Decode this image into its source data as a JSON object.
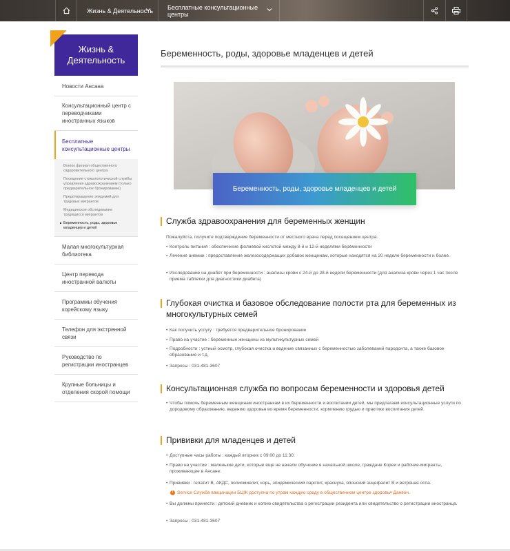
{
  "topbar": {
    "crumb1": "Жизнь & Деятельность",
    "crumb2": "Бесплатные консультационные центры"
  },
  "sidebar": {
    "title": "Жизнь & Деятельность",
    "items": [
      {
        "label": "Новости Ансана"
      },
      {
        "label": "Консультационный центр с переводчиками иностранных языков"
      },
      {
        "label": "Бесплатные консультационные центры"
      },
      {
        "label": "Малая многокультурная библиотека"
      },
      {
        "label": "Центр перевода иностранной валюты"
      },
      {
        "label": "Программы обучения корейскому языку"
      },
      {
        "label": "Телефон для экстренной связи"
      },
      {
        "label": "Руководство по регистрации иностранцев"
      },
      {
        "label": "Крупные больницы и отделения скорой помощи"
      }
    ],
    "subitems": [
      {
        "label": "Вонгок филиал общественного оздоровительного центра"
      },
      {
        "label": "Посещение стоматологической службы управления здравоохранением (только предварительное бронирование)"
      },
      {
        "label": "Предотвращение эпидемий для трудовых мигрантов"
      },
      {
        "label": "Медицинское обследование трудящихся мигрантов"
      },
      {
        "label": "Беременность, роды, здоровье младенцев и детей"
      }
    ]
  },
  "main": {
    "title": "Беременность, роды, здоровье младенцев и детей",
    "hero_caption": "Беременность, роды, здоровье младенцев и детей",
    "s1": {
      "title": "Служба здравоохранения для беременных женщин",
      "intro": "Пожалуйста, получите подтверждение беременности от местного врача перед посещением центра.",
      "b1": "Контроль питания : обеспечение фолиевой кислотой между 8-й и 12-й неделями беременности",
      "b2": "Лечение анемии : предоставление железосодержащих добавок женщинам, которые находятся на 20 неделе беременности и более.",
      "b3": "Исследование на диабет при беременности : анализы крови с 24-й до 28-й недели беременности (для анализа крови через 1 час после приема таблетки для диагностики диабета)"
    },
    "s2": {
      "title": "Глубокая очистка и базовое обследование полости рта для беременных из многокультурных семей",
      "b1": "Как получить услугу : требуется предварительное бронирование",
      "b2": "Право на участие : беременные женщины из мультикультурных семей",
      "b3": "Подробности : устный осмотр, глубокая очистка и ведение связанных с беременностью заболеваний пародонта, а также базовое образование и т.д.",
      "b4": "Запросы : 031-481-3607"
    },
    "s3": {
      "title": "Консультационная служба по вопросам беременности и здоровья детей",
      "b1": "Чтобы помочь беременным женщинам иностранкам в их беременности и воспитании детей, мы предлагаем консультационные услуги по дородовому образованию, ведению здоровья во время беременности, кормлению грудью и практике воспитания детей."
    },
    "s4": {
      "title": "Прививки для младенцев и детей",
      "b1": "Доступные часы работы : каждый вторник с 09:00 до 11:30.",
      "b2": "Право на участие : маленькие дети, которые еще не начали обучение в начальной школе, граждане Кореи и рабочие-мигранты, проживающие в Ансане.",
      "b3": "Прививки : гепатит B, АКДС, полиомиелит, корь, эпидемический паротит, краснуха, японский энцефалит B и ветряная оспа.",
      "warn": "Service Служба вакцинации БЦЖ доступна по утрам каждую среду в общественном центре здоровья Данвон.",
      "b4": "Вы должны принести : детский дневник и копию свидетельства о регистрации резидента или свидетельство о регистрации иностранца.",
      "b5": "Запросы : 031-481-3607"
    }
  }
}
